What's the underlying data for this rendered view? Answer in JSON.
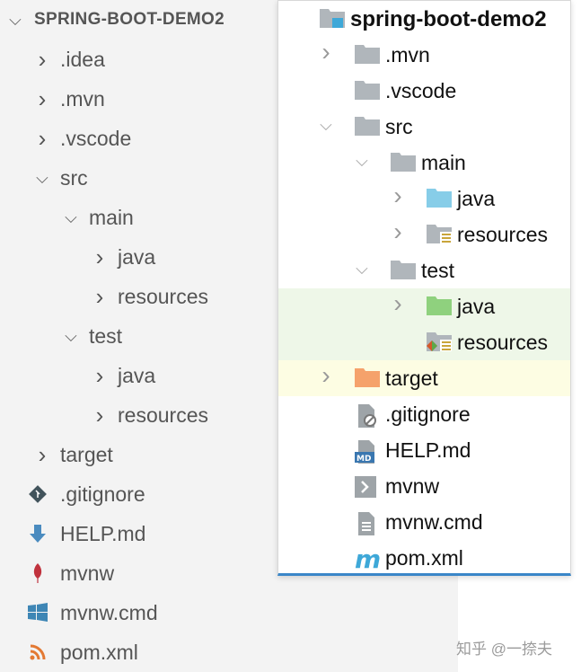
{
  "vscode_explorer": {
    "title": "SPRING-BOOT-DEMO2",
    "items": [
      {
        "label": ".idea",
        "level": 0,
        "state": "collapsed"
      },
      {
        "label": ".mvn",
        "level": 0,
        "state": "collapsed"
      },
      {
        "label": ".vscode",
        "level": 0,
        "state": "collapsed"
      },
      {
        "label": "src",
        "level": 0,
        "state": "expanded"
      },
      {
        "label": "main",
        "level": 1,
        "state": "expanded"
      },
      {
        "label": "java",
        "level": 2,
        "state": "collapsed"
      },
      {
        "label": "resources",
        "level": 2,
        "state": "collapsed"
      },
      {
        "label": "test",
        "level": 1,
        "state": "expanded"
      },
      {
        "label": "java",
        "level": 2,
        "state": "collapsed"
      },
      {
        "label": "resources",
        "level": 2,
        "state": "collapsed"
      },
      {
        "label": "target",
        "level": 0,
        "state": "collapsed"
      },
      {
        "label": ".gitignore",
        "level": 0,
        "icon": "git-icon"
      },
      {
        "label": "HELP.md",
        "level": 0,
        "icon": "markdown-download-icon"
      },
      {
        "label": "mvnw",
        "level": 0,
        "icon": "feather-icon"
      },
      {
        "label": "mvnw.cmd",
        "level": 0,
        "icon": "windows-icon"
      },
      {
        "label": "pom.xml",
        "level": 0,
        "icon": "rss-icon"
      }
    ]
  },
  "idea_project": {
    "items": [
      {
        "label": "spring-boot-demo2",
        "level": -1,
        "icon": "module-folder-icon"
      },
      {
        "label": ".mvn",
        "level": 0,
        "state": "collapsed",
        "icon": "folder-icon"
      },
      {
        "label": ".vscode",
        "level": 0,
        "icon": "folder-icon"
      },
      {
        "label": "src",
        "level": 0,
        "state": "expanded",
        "icon": "folder-icon"
      },
      {
        "label": "main",
        "level": 1,
        "state": "expanded",
        "icon": "folder-icon"
      },
      {
        "label": "java",
        "level": 2,
        "state": "collapsed",
        "icon": "source-folder-icon"
      },
      {
        "label": "resources",
        "level": 2,
        "state": "collapsed",
        "icon": "resources-folder-icon"
      },
      {
        "label": "test",
        "level": 1,
        "state": "expanded",
        "icon": "folder-icon"
      },
      {
        "label": "java",
        "level": 2,
        "state": "collapsed",
        "icon": "test-source-folder-icon",
        "highlight": "green"
      },
      {
        "label": "resources",
        "level": 2,
        "icon": "test-resources-folder-icon",
        "highlight": "green"
      },
      {
        "label": "target",
        "level": 0,
        "state": "collapsed",
        "icon": "excluded-folder-icon",
        "highlight": "yellow"
      },
      {
        "label": ".gitignore",
        "level": 0,
        "icon": "ignored-file-icon"
      },
      {
        "label": "HELP.md",
        "level": 0,
        "icon": "md-file-icon"
      },
      {
        "label": "mvnw",
        "level": 0,
        "icon": "shell-file-icon"
      },
      {
        "label": "mvnw.cmd",
        "level": 0,
        "icon": "text-file-icon"
      },
      {
        "label": "pom.xml",
        "level": 0,
        "icon": "maven-icon"
      }
    ]
  },
  "colors": {
    "folder": "#b0b6bb",
    "source": "#87cde8",
    "test": "#8fd17e",
    "target": "#f5a26b",
    "green_row": "#eef7e8",
    "yellow_row": "#fdfde3",
    "accent": "#3a86c8"
  },
  "watermark": "知乎 @一捺夫"
}
